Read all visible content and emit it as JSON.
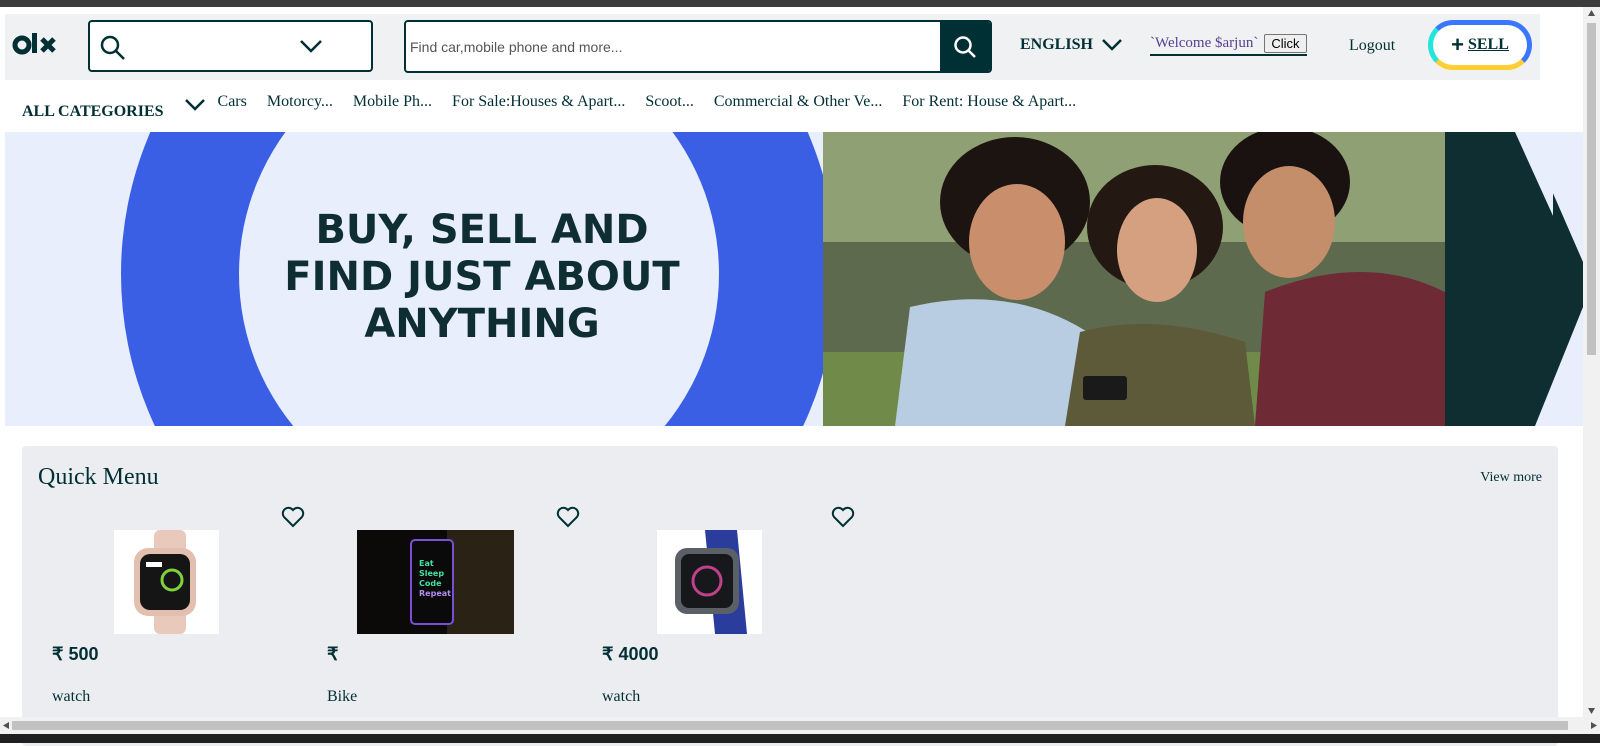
{
  "header": {
    "logo_text": "olx",
    "search_placeholder": "Find car,mobile phone and more...",
    "language": "ENGLISH",
    "welcome_text": "`Welcome $arjun`",
    "click_label": "Click",
    "logout_label": "Logout",
    "sell_label": "SELL",
    "sell_plus": "+"
  },
  "categories": {
    "all_label": "ALL CATEGORIES",
    "items": [
      "Cars",
      "Motorcy...",
      "Mobile Ph...",
      "For Sale:Houses & Apart...",
      "Scoot...",
      "Commercial & Other Ve...",
      "For Rent: House & Apart..."
    ]
  },
  "hero": {
    "lines": [
      "BUY, SELL AND",
      "FIND JUST ABOUT",
      "ANYTHING"
    ],
    "colors": {
      "blue": "#3a5fe5",
      "light": "#e8eefb",
      "dark": "#0e2e31"
    }
  },
  "quick_menu": {
    "title": "Quick Menu",
    "view_more": "View more",
    "cards": [
      {
        "price": "₹ 500",
        "title": "watch",
        "image": "pink-smartwatch"
      },
      {
        "price": "₹",
        "title": "Bike",
        "image": "phone-eat-sleep-code-repeat"
      },
      {
        "price": "₹ 4000",
        "title": "watch",
        "image": "blue-smartwatch"
      }
    ],
    "phone_text": [
      "Eat",
      "Sleep",
      "Code",
      "Repeat"
    ]
  }
}
